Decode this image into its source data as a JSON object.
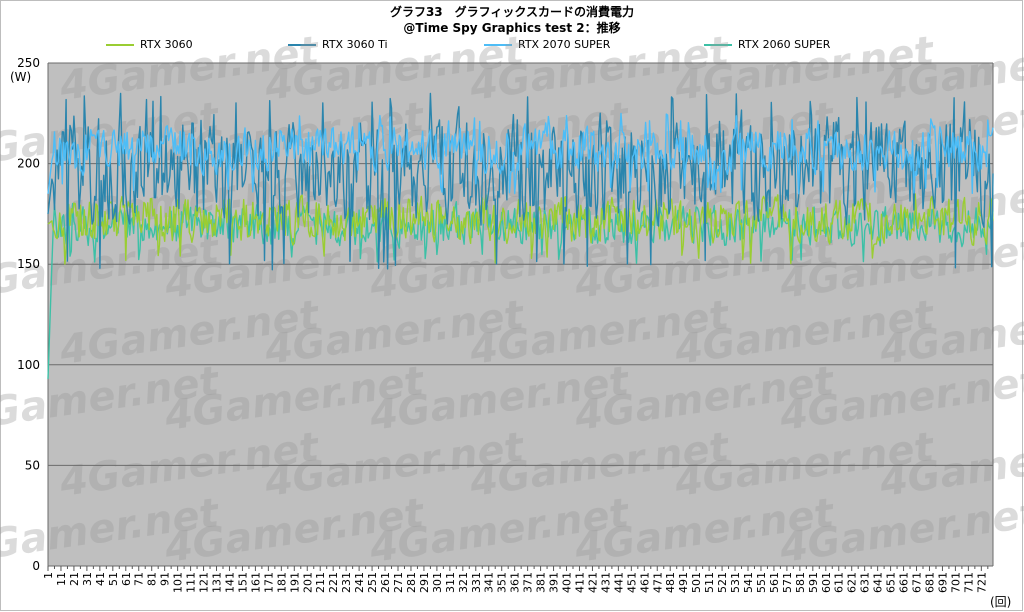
{
  "chart_data": {
    "type": "line",
    "title": "グラフ33　グラフィックスカードの消費電力",
    "subtitle": "@Time Spy Graphics test 2：推移",
    "ylabel": "(W)",
    "xlabel": "(回)",
    "ylim": [
      0,
      250
    ],
    "yticks": [
      0,
      50,
      100,
      150,
      200,
      250
    ],
    "xlim": [
      1,
      730
    ],
    "xticks": [
      1,
      11,
      21,
      31,
      41,
      51,
      61,
      71,
      81,
      91,
      101,
      111,
      121,
      131,
      141,
      151,
      161,
      171,
      181,
      191,
      201,
      211,
      221,
      231,
      241,
      251,
      261,
      271,
      281,
      291,
      301,
      311,
      321,
      331,
      341,
      351,
      361,
      371,
      381,
      391,
      401,
      411,
      421,
      431,
      441,
      451,
      461,
      471,
      481,
      491,
      501,
      511,
      521,
      531,
      541,
      551,
      561,
      571,
      581,
      591,
      601,
      611,
      621,
      631,
      641,
      651,
      661,
      671,
      681,
      691,
      701,
      711,
      721
    ],
    "grid": true,
    "legend_position": "top",
    "watermark": "4Gamer.net",
    "series": [
      {
        "name": "RTX 3060",
        "color": "#9acd32",
        "mean": 172,
        "low": 150,
        "high": 185,
        "start": 170
      },
      {
        "name": "RTX 3060 Ti",
        "color": "#2a85ad",
        "mean": 198,
        "low": 147,
        "high": 235,
        "start": 175
      },
      {
        "name": "RTX 2070 SUPER",
        "color": "#4dbdf7",
        "mean": 207,
        "low": 185,
        "high": 225,
        "start": 185
      },
      {
        "name": "RTX 2060 SUPER",
        "color": "#3cc0a6",
        "mean": 169,
        "low": 150,
        "high": 182,
        "start": 93
      }
    ]
  }
}
